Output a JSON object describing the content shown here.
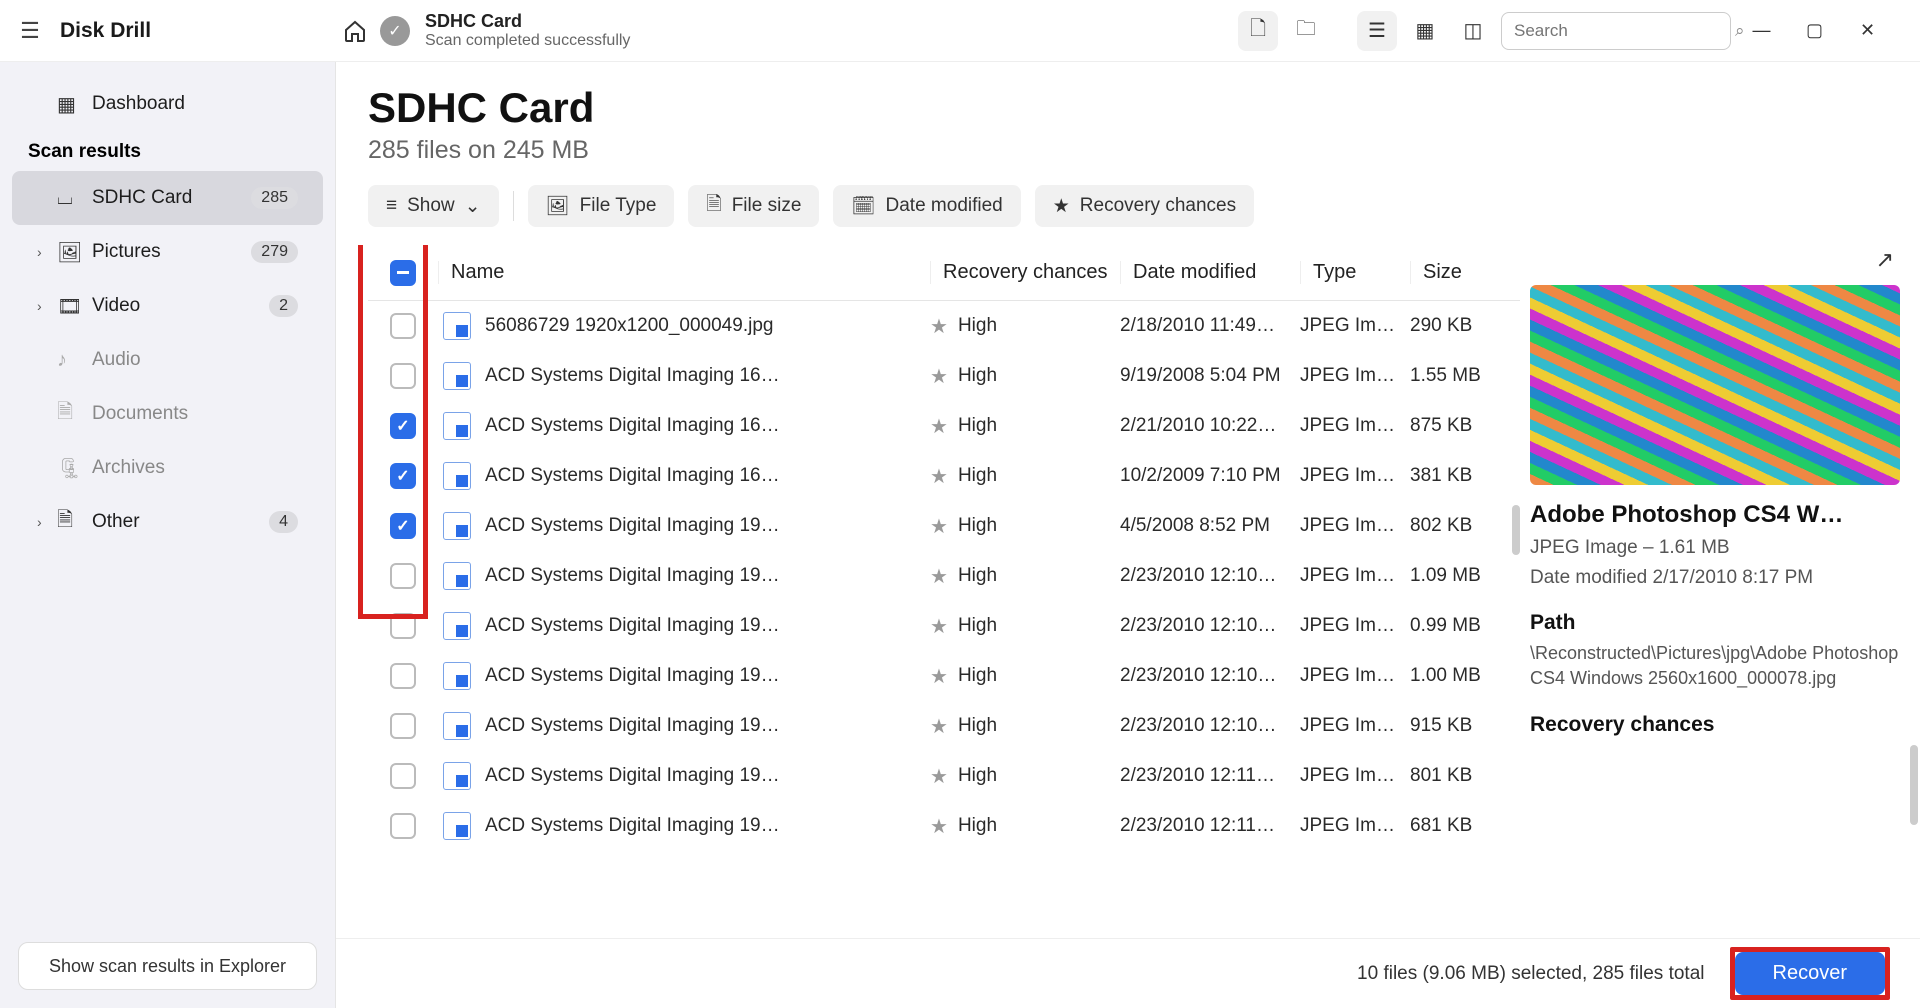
{
  "app": {
    "title": "Disk Drill"
  },
  "sidebar": {
    "dashboard": "Dashboard",
    "section": "Scan results",
    "items": [
      {
        "label": "SDHC Card",
        "count": "285",
        "icon": "⌴",
        "active": true,
        "expand": false
      },
      {
        "label": "Pictures",
        "count": "279",
        "icon": "🖼",
        "expand": true
      },
      {
        "label": "Video",
        "count": "2",
        "icon": "🎞",
        "expand": true
      },
      {
        "label": "Audio",
        "icon": "♪",
        "muted": true
      },
      {
        "label": "Documents",
        "icon": "🗎",
        "muted": true
      },
      {
        "label": "Archives",
        "icon": "🗜",
        "muted": true
      },
      {
        "label": "Other",
        "count": "4",
        "icon": "🗎",
        "expand": true
      }
    ],
    "footer": "Show scan results in Explorer"
  },
  "header": {
    "title": "SDHC Card",
    "subtitle": "Scan completed successfully",
    "search_placeholder": "Search"
  },
  "page": {
    "title": "SDHC Card",
    "subtitle": "285 files on 245 MB"
  },
  "filters": {
    "show": "Show",
    "file_type": "File Type",
    "file_size": "File size",
    "date_modified": "Date modified",
    "recovery": "Recovery chances"
  },
  "columns": {
    "name": "Name",
    "recovery": "Recovery chances",
    "date": "Date modified",
    "type": "Type",
    "size": "Size"
  },
  "rows": [
    {
      "checked": false,
      "name": "56086729 1920x1200_000049.jpg",
      "rec": "High",
      "date": "2/18/2010 11:49…",
      "type": "JPEG Im…",
      "size": "290 KB"
    },
    {
      "checked": false,
      "name": "ACD Systems Digital Imaging 16…",
      "rec": "High",
      "date": "9/19/2008 5:04 PM",
      "type": "JPEG Im…",
      "size": "1.55 MB"
    },
    {
      "checked": true,
      "name": "ACD Systems Digital Imaging 16…",
      "rec": "High",
      "date": "2/21/2010 10:22…",
      "type": "JPEG Im…",
      "size": "875 KB"
    },
    {
      "checked": true,
      "name": "ACD Systems Digital Imaging 16…",
      "rec": "High",
      "date": "10/2/2009 7:10 PM",
      "type": "JPEG Im…",
      "size": "381 KB"
    },
    {
      "checked": true,
      "name": "ACD Systems Digital Imaging 19…",
      "rec": "High",
      "date": "4/5/2008 8:52 PM",
      "type": "JPEG Im…",
      "size": "802 KB"
    },
    {
      "checked": false,
      "name": "ACD Systems Digital Imaging 19…",
      "rec": "High",
      "date": "2/23/2010 12:10…",
      "type": "JPEG Im…",
      "size": "1.09 MB"
    },
    {
      "checked": false,
      "name": "ACD Systems Digital Imaging 19…",
      "rec": "High",
      "date": "2/23/2010 12:10…",
      "type": "JPEG Im…",
      "size": "0.99 MB"
    },
    {
      "checked": false,
      "name": "ACD Systems Digital Imaging 19…",
      "rec": "High",
      "date": "2/23/2010 12:10…",
      "type": "JPEG Im…",
      "size": "1.00 MB"
    },
    {
      "checked": false,
      "name": "ACD Systems Digital Imaging 19…",
      "rec": "High",
      "date": "2/23/2010 12:10…",
      "type": "JPEG Im…",
      "size": "915 KB"
    },
    {
      "checked": false,
      "name": "ACD Systems Digital Imaging 19…",
      "rec": "High",
      "date": "2/23/2010 12:11…",
      "type": "JPEG Im…",
      "size": "801 KB"
    },
    {
      "checked": false,
      "name": "ACD Systems Digital Imaging 19…",
      "rec": "High",
      "date": "2/23/2010 12:11…",
      "type": "JPEG Im…",
      "size": "681 KB"
    }
  ],
  "preview": {
    "title": "Adobe Photoshop CS4 W…",
    "meta1": "JPEG Image – 1.61 MB",
    "meta2": "Date modified 2/17/2010 8:17 PM",
    "path_label": "Path",
    "path": "\\Reconstructed\\Pictures\\jpg\\Adobe Photoshop CS4 Windows 2560x1600_000078.jpg",
    "rec_label": "Recovery chances"
  },
  "status": {
    "text": "10 files (9.06 MB) selected, 285 files total",
    "recover": "Recover"
  }
}
